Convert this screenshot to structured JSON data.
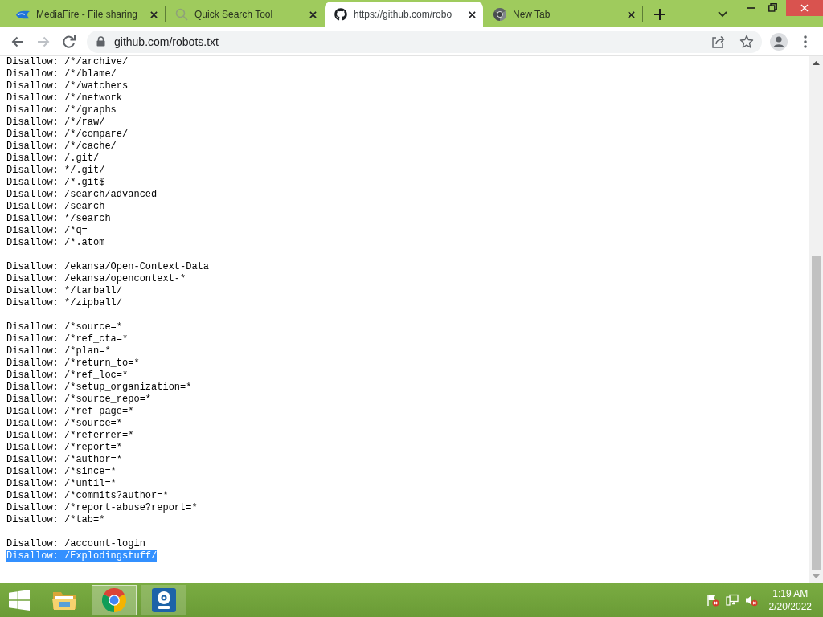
{
  "browser": {
    "tabs": [
      {
        "kind": "mediafire",
        "title": "MediaFire - File sharing",
        "selected": false
      },
      {
        "kind": "search",
        "title": "Quick Search Tool",
        "selected": false
      },
      {
        "kind": "github",
        "title": "https://github.com/robo",
        "selected": true
      },
      {
        "kind": "chrome",
        "title": "New Tab",
        "selected": false
      }
    ],
    "nav_buttons": [
      {
        "kind": "back",
        "disabled": false
      },
      {
        "kind": "forward",
        "disabled": true
      },
      {
        "kind": "reload",
        "disabled": false
      }
    ],
    "address_bar": {
      "url": "github.com/robots.txt"
    }
  },
  "document": {
    "blocks": [
      {
        "lines": [
          {
            "text": "Disallow: /*/archive/",
            "selected": false
          },
          {
            "text": "Disallow: /*/blame/",
            "selected": false
          },
          {
            "text": "Disallow: /*/watchers",
            "selected": false
          },
          {
            "text": "Disallow: /*/network",
            "selected": false
          },
          {
            "text": "Disallow: /*/graphs",
            "selected": false
          },
          {
            "text": "Disallow: /*/raw/",
            "selected": false
          },
          {
            "text": "Disallow: /*/compare/",
            "selected": false
          },
          {
            "text": "Disallow: /*/cache/",
            "selected": false
          },
          {
            "text": "Disallow: /.git/",
            "selected": false
          },
          {
            "text": "Disallow: */.git/",
            "selected": false
          },
          {
            "text": "Disallow: /*.git$",
            "selected": false
          },
          {
            "text": "Disallow: /search/advanced",
            "selected": false
          },
          {
            "text": "Disallow: /search",
            "selected": false
          },
          {
            "text": "Disallow: */search",
            "selected": false
          },
          {
            "text": "Disallow: /*q=",
            "selected": false
          },
          {
            "text": "Disallow: /*.atom",
            "selected": false
          }
        ]
      },
      {
        "lines": [
          {
            "text": "Disallow: /ekansa/Open-Context-Data",
            "selected": false
          },
          {
            "text": "Disallow: /ekansa/opencontext-*",
            "selected": false
          },
          {
            "text": "Disallow: */tarball/",
            "selected": false
          },
          {
            "text": "Disallow: */zipball/",
            "selected": false
          }
        ]
      },
      {
        "lines": [
          {
            "text": "Disallow: /*source=*",
            "selected": false
          },
          {
            "text": "Disallow: /*ref_cta=*",
            "selected": false
          },
          {
            "text": "Disallow: /*plan=*",
            "selected": false
          },
          {
            "text": "Disallow: /*return_to=*",
            "selected": false
          },
          {
            "text": "Disallow: /*ref_loc=*",
            "selected": false
          },
          {
            "text": "Disallow: /*setup_organization=*",
            "selected": false
          },
          {
            "text": "Disallow: /*source_repo=*",
            "selected": false
          },
          {
            "text": "Disallow: /*ref_page=*",
            "selected": false
          },
          {
            "text": "Disallow: /*source=*",
            "selected": false
          },
          {
            "text": "Disallow: /*referrer=*",
            "selected": false
          },
          {
            "text": "Disallow: /*report=*",
            "selected": false
          },
          {
            "text": "Disallow: /*author=*",
            "selected": false
          },
          {
            "text": "Disallow: /*since=*",
            "selected": false
          },
          {
            "text": "Disallow: /*until=*",
            "selected": false
          },
          {
            "text": "Disallow: /*commits?author=*",
            "selected": false
          },
          {
            "text": "Disallow: /*report-abuse?report=*",
            "selected": false
          },
          {
            "text": "Disallow: /*tab=*",
            "selected": false
          }
        ]
      },
      {
        "lines": [
          {
            "text": "Disallow: /account-login",
            "selected": false
          },
          {
            "text": "Disallow: /Explodingstuff/",
            "selected": true
          }
        ]
      }
    ]
  },
  "taskbar": {
    "apps": [
      {
        "kind": "explorer",
        "running": false,
        "selected": false
      },
      {
        "kind": "chrome",
        "running": true,
        "selected": true
      },
      {
        "kind": "media",
        "running": true,
        "selected": false
      }
    ],
    "clock": {
      "time": "1:19 AM",
      "date": "2/20/2022"
    }
  }
}
